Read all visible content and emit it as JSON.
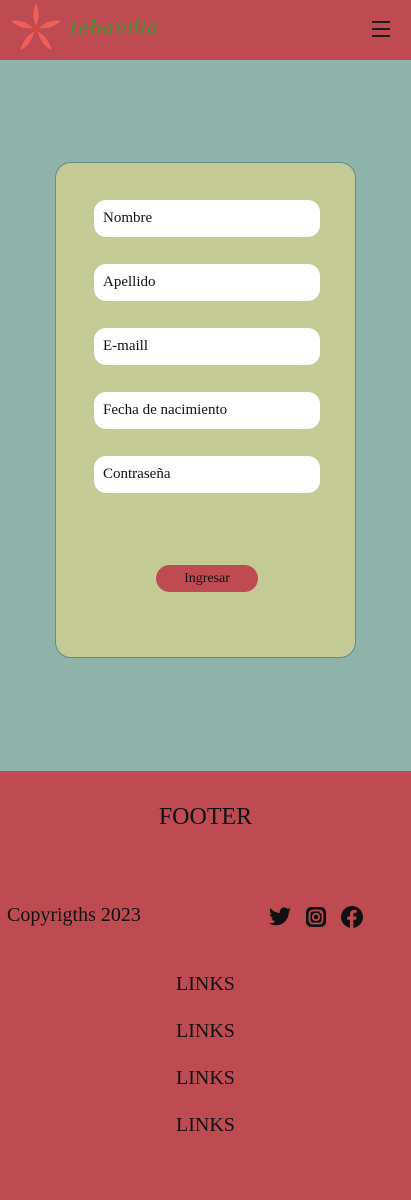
{
  "header": {
    "brand": "tebanilia",
    "logo_icon": "flower-logo-icon",
    "menu_icon": "hamburger-menu-icon"
  },
  "form": {
    "fields": [
      {
        "label": "Nombre"
      },
      {
        "label": "Apellido"
      },
      {
        "label": "E-maill"
      },
      {
        "label": "Fecha de nacimiento"
      },
      {
        "label": "Contraseña"
      }
    ],
    "submit_label": "Ingresar"
  },
  "footer": {
    "title": "FOOTER",
    "copyright": "Copyrigths 2023",
    "social_icons": [
      "twitter-icon",
      "instagram-icon",
      "facebook-icon"
    ],
    "links": [
      "LINKS",
      "LINKS",
      "LINKS",
      "LINKS"
    ]
  },
  "colors": {
    "header_bg": "#bd4b51",
    "page_bg": "#8fb3a8",
    "card_bg": "#c3ca94",
    "brand_text": "#2f9e2f",
    "logo": "#f0605a"
  }
}
